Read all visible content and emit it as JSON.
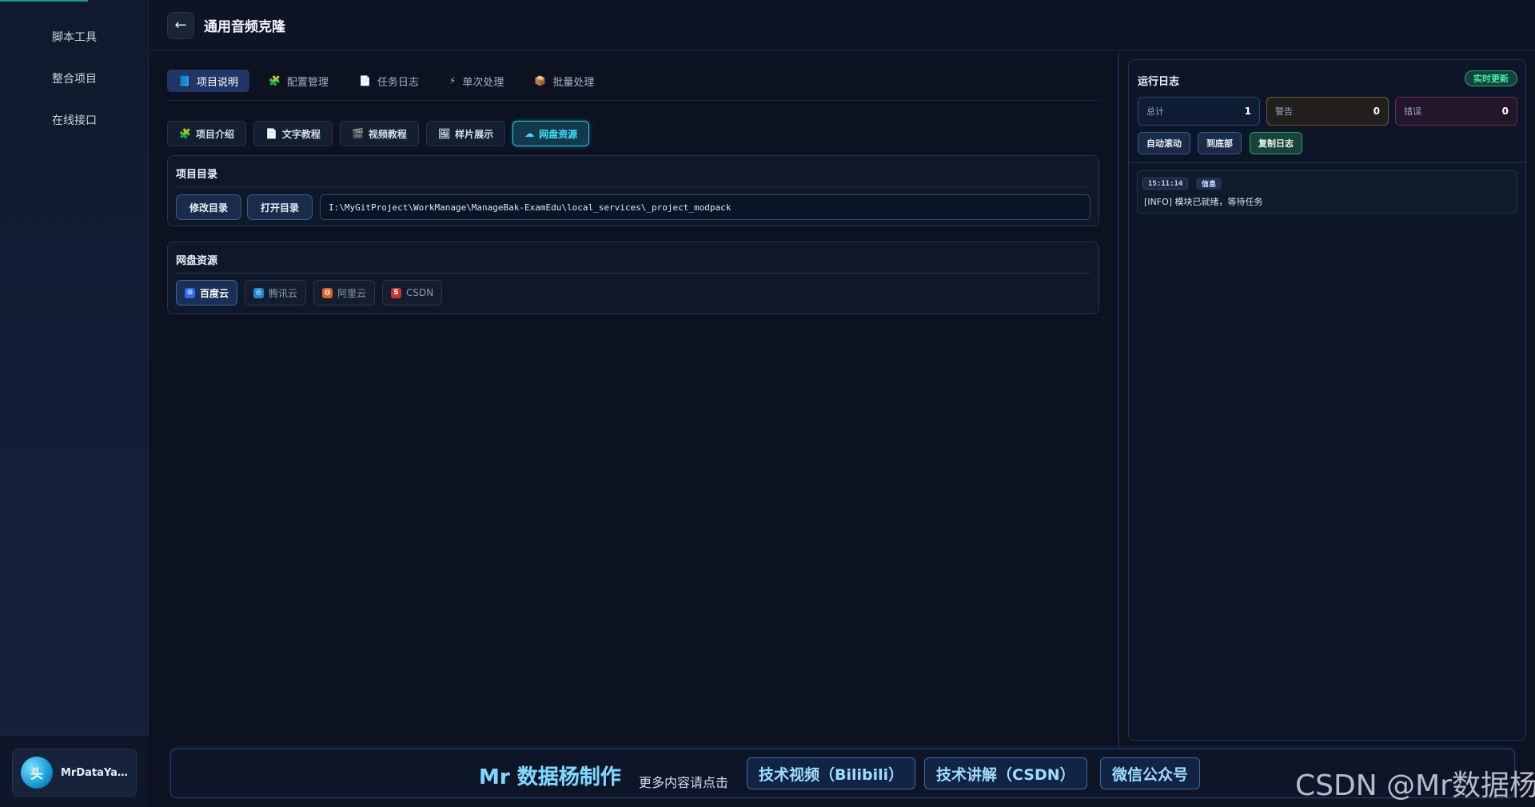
{
  "sidebar": {
    "items": [
      {
        "label": "脚本工具"
      },
      {
        "label": "整合项目"
      },
      {
        "label": "在线接口"
      }
    ],
    "user": {
      "avatar_text": "头",
      "name": "MrDataYan..."
    }
  },
  "header": {
    "back_icon": "←",
    "title": "通用音频克隆"
  },
  "tabs": [
    {
      "icon": "📘",
      "label": "项目说明"
    },
    {
      "icon": "🧩",
      "label": "配置管理"
    },
    {
      "icon": "📄",
      "label": "任务日志"
    },
    {
      "icon": "⚡",
      "label": "单次处理"
    },
    {
      "icon": "📦",
      "label": "批量处理"
    }
  ],
  "subtabs": [
    {
      "icon": "🧩",
      "label": "项目介绍"
    },
    {
      "icon": "📄",
      "label": "文字教程"
    },
    {
      "icon": "🎬",
      "label": "视频教程"
    },
    {
      "icon": "🖼",
      "label": "样片展示"
    },
    {
      "icon": "☁",
      "label": "网盘资源"
    }
  ],
  "project_dir": {
    "title": "项目目录",
    "modify_label": "修改目录",
    "open_label": "打开目录",
    "path": "I:\\MyGitProject\\WorkManage\\ManageBak-ExamEdu\\local_services\\_project_modpack"
  },
  "cloud": {
    "title": "网盘资源",
    "buttons": [
      {
        "label": "百度云",
        "icon_text": "⊙",
        "color": "#2d6cf0"
      },
      {
        "label": "腾讯云",
        "icon_text": "◎",
        "color": "#1e88c8"
      },
      {
        "label": "阿里云",
        "icon_text": "◍",
        "color": "#d0652b"
      },
      {
        "label": "CSDN",
        "icon_text": "S",
        "color": "#c8352d"
      }
    ]
  },
  "log": {
    "title": "运行日志",
    "live_badge": "实时更新",
    "stats": {
      "total_label": "总计",
      "total": "1",
      "warn_label": "警告",
      "warn": "0",
      "error_label": "错误",
      "error": "0"
    },
    "buttons": {
      "auto_scroll": "自动滚动",
      "to_bottom": "到底部",
      "copy": "复制日志"
    },
    "entries": [
      {
        "time": "15:11:14",
        "level": "信息",
        "message": "[INFO] 模块已就绪，等待任务"
      }
    ]
  },
  "footer": {
    "brand": "Mr 数据杨制作",
    "sub": "更多内容请点击",
    "links": [
      "技术视频（Bilibili）",
      "技术讲解（CSDN）",
      "微信公众号"
    ]
  },
  "watermark": "CSDN @Mr数据杨",
  "colors": {
    "accent": "#2fc8e6",
    "active_tab": "#1f3766",
    "live": "#3ef0a8"
  }
}
